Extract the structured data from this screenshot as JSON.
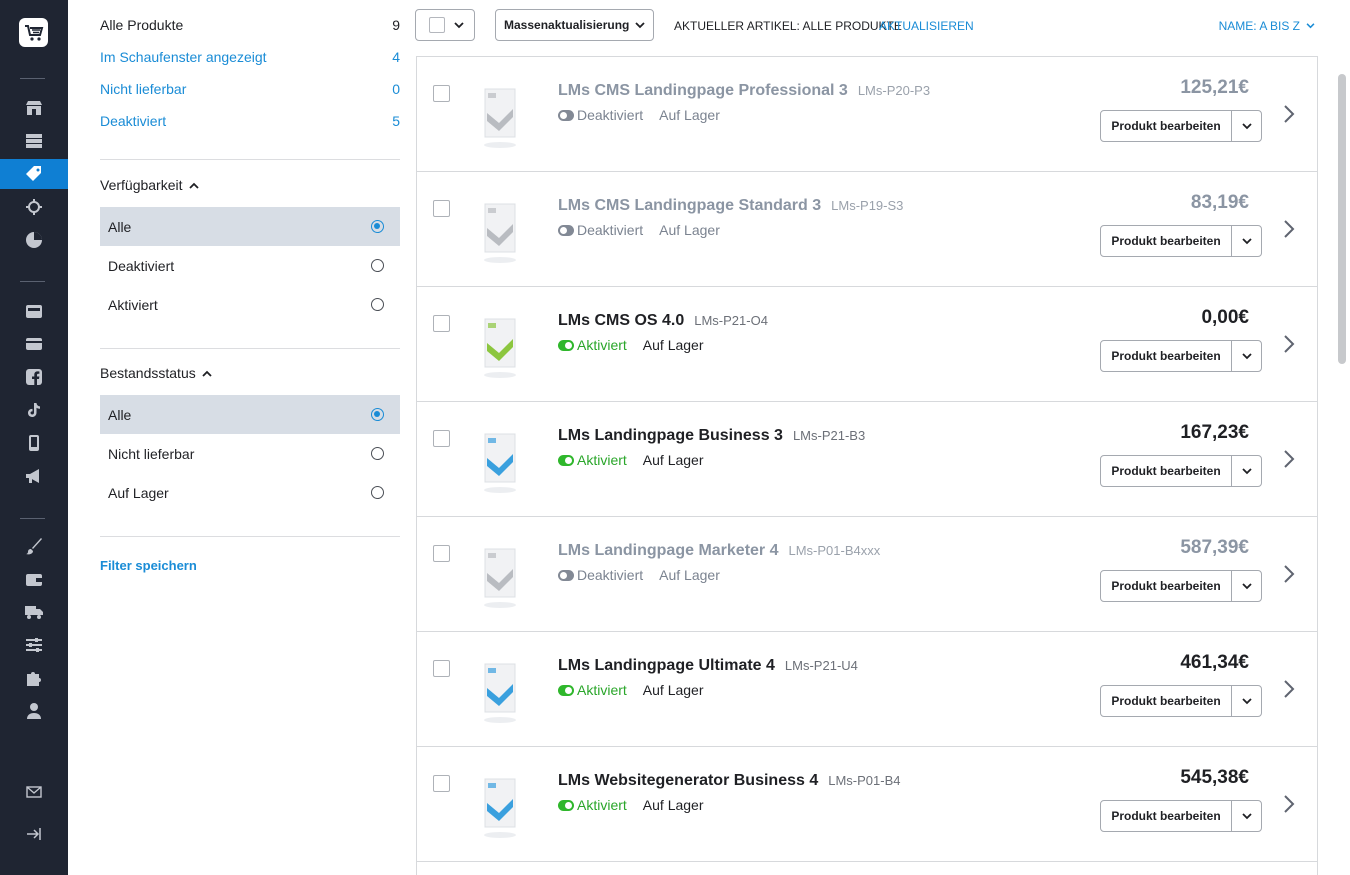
{
  "rail": {
    "items": [
      "store-icon",
      "inventory-icon",
      "tag-icon",
      "target-icon",
      "pie-chart-icon",
      "shop-icon",
      "card-icon",
      "facebook-icon",
      "tiktok-icon",
      "mobile-icon",
      "megaphone-icon",
      "brush-icon",
      "wallet-icon",
      "truck-icon",
      "sliders-icon",
      "puzzle-icon",
      "user-icon",
      "mail-icon",
      "logout-icon"
    ],
    "active": "tag-icon"
  },
  "filters": {
    "quick": [
      {
        "label": "Alle Produkte",
        "count": "9"
      },
      {
        "label": "Im Schaufenster angezeigt",
        "count": "4"
      },
      {
        "label": "Nicht lieferbar",
        "count": "0"
      },
      {
        "label": "Deaktiviert",
        "count": "5"
      }
    ],
    "availability": {
      "title": "Verfügbarkeit",
      "options": [
        "Alle",
        "Deaktiviert",
        "Aktiviert"
      ],
      "selected": "Alle"
    },
    "stock": {
      "title": "Bestandsstatus",
      "options": [
        "Alle",
        "Nicht lieferbar",
        "Auf Lager"
      ],
      "selected": "Alle"
    },
    "save_label": "Filter speichern"
  },
  "toolbar": {
    "bulk_label": "Massenaktualisierung",
    "current_label": "AKTUELLER ARTIKEL: ALLE PRODUKTE",
    "refresh_label": "AKTUALISIEREN",
    "sort_label": "NAME: A BIS Z"
  },
  "products": [
    {
      "name": "LMs CMS Landingpage Professional 3",
      "sku": "LMs-P20-P3",
      "status": "Deaktiviert",
      "active": false,
      "stock": "Auf Lager",
      "price": "125,21€",
      "edit": "Produkt bearbeiten",
      "box_color": "#b9bcc1"
    },
    {
      "name": "LMs CMS Landingpage Standard 3",
      "sku": "LMs-P19-S3",
      "status": "Deaktiviert",
      "active": false,
      "stock": "Auf Lager",
      "price": "83,19€",
      "edit": "Produkt bearbeiten",
      "box_color": "#b9bcc1"
    },
    {
      "name": "LMs CMS OS 4.0",
      "sku": "LMs-P21-O4",
      "status": "Aktiviert",
      "active": true,
      "stock": "Auf Lager",
      "price": "0,00€",
      "edit": "Produkt bearbeiten",
      "box_color": "#8cc63f"
    },
    {
      "name": "LMs Landingpage Business 3",
      "sku": "LMs-P21-B3",
      "status": "Aktiviert",
      "active": true,
      "stock": "Auf Lager",
      "price": "167,23€",
      "edit": "Produkt bearbeiten",
      "box_color": "#3aa0de"
    },
    {
      "name": "LMs Landingpage Marketer 4",
      "sku": "LMs-P01-B4xxx",
      "status": "Deaktiviert",
      "active": false,
      "stock": "Auf Lager",
      "price": "587,39€",
      "edit": "Produkt bearbeiten",
      "box_color": "#b9bcc1"
    },
    {
      "name": "LMs Landingpage Ultimate 4",
      "sku": "LMs-P21-U4",
      "status": "Aktiviert",
      "active": true,
      "stock": "Auf Lager",
      "price": "461,34€",
      "edit": "Produkt bearbeiten",
      "box_color": "#3aa0de"
    },
    {
      "name": "LMs Websitegenerator Business 4",
      "sku": "LMs-P01-B4",
      "status": "Aktiviert",
      "active": true,
      "stock": "Auf Lager",
      "price": "545,38€",
      "edit": "Produkt bearbeiten",
      "box_color": "#3aa0de"
    }
  ],
  "colors": {
    "accent": "#1a8cd6",
    "rail": "#1f2532",
    "active_rail": "#0f7fd3",
    "green": "#2fb72c"
  }
}
